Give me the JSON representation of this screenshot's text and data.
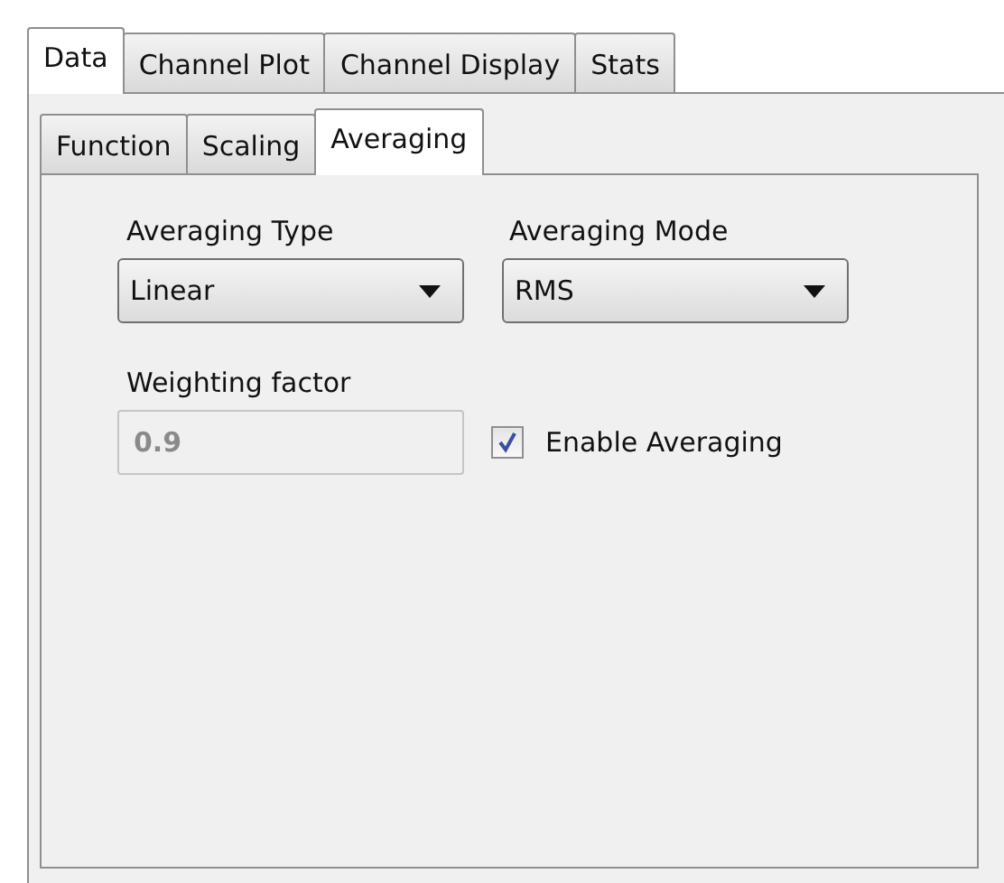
{
  "outer_tabs": [
    {
      "label": "Data",
      "selected": true
    },
    {
      "label": "Channel Plot",
      "selected": false
    },
    {
      "label": "Channel Display",
      "selected": false
    },
    {
      "label": "Stats",
      "selected": false
    }
  ],
  "inner_tabs": [
    {
      "label": "Function",
      "selected": false
    },
    {
      "label": "Scaling",
      "selected": false
    },
    {
      "label": "Averaging",
      "selected": true
    }
  ],
  "averaging_type": {
    "label": "Averaging Type",
    "value": "Linear"
  },
  "averaging_mode": {
    "label": "Averaging Mode",
    "value": "RMS"
  },
  "weighting_factor": {
    "label": "Weighting factor",
    "value": "0.9",
    "disabled": true
  },
  "enable_averaging": {
    "label": "Enable Averaging",
    "checked": true
  }
}
